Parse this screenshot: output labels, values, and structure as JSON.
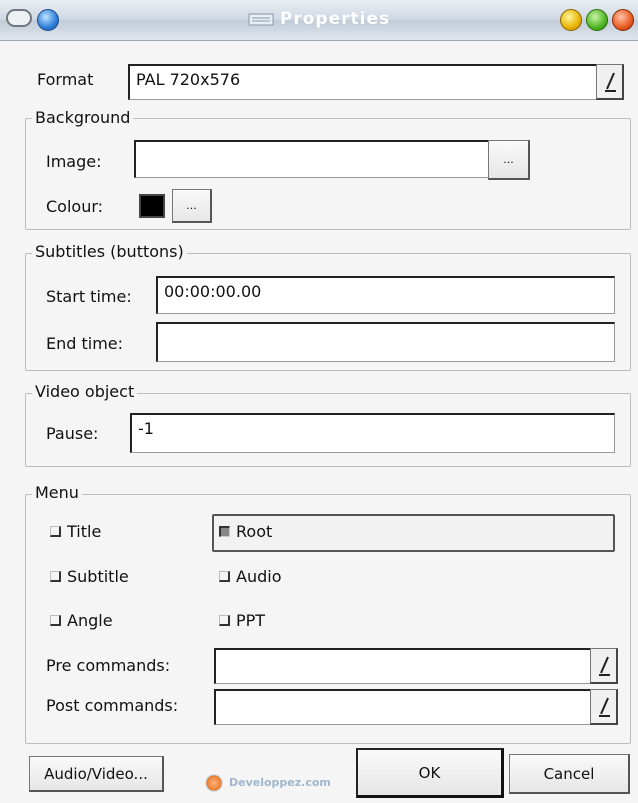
{
  "window": {
    "title": "Properties",
    "buttons": [
      "close-icon",
      "zoom-icon",
      "minimize-icon"
    ]
  },
  "format": {
    "label": "Format",
    "value": "PAL 720x576"
  },
  "background": {
    "group_label": "Background",
    "image_label": "Image:",
    "image_value": "",
    "browse_label": "...",
    "colour_label": "Colour:",
    "colour_value": "#000000",
    "colour_button_label": "..."
  },
  "subtitles": {
    "group_label": "Subtitles (buttons)",
    "start_label": "Start time:",
    "start_value": "00:00:00.00",
    "end_label": "End time:",
    "end_value": ""
  },
  "video_object": {
    "group_label": "Video object",
    "pause_label": "Pause:",
    "pause_value": "-1"
  },
  "menu": {
    "group_label": "Menu",
    "checkboxes": [
      {
        "label": "Title",
        "checked": false
      },
      {
        "label": "Root",
        "checked": true
      },
      {
        "label": "Subtitle",
        "checked": false
      },
      {
        "label": "Audio",
        "checked": false
      },
      {
        "label": "Angle",
        "checked": false
      },
      {
        "label": "PPT",
        "checked": false
      }
    ],
    "pre_label": "Pre commands:",
    "pre_value": "",
    "post_label": "Post commands:",
    "post_value": ""
  },
  "footer": {
    "audio_video_label": "Audio/Video...",
    "ok_label": "OK",
    "cancel_label": "Cancel",
    "watermark": "Developpez.com"
  }
}
